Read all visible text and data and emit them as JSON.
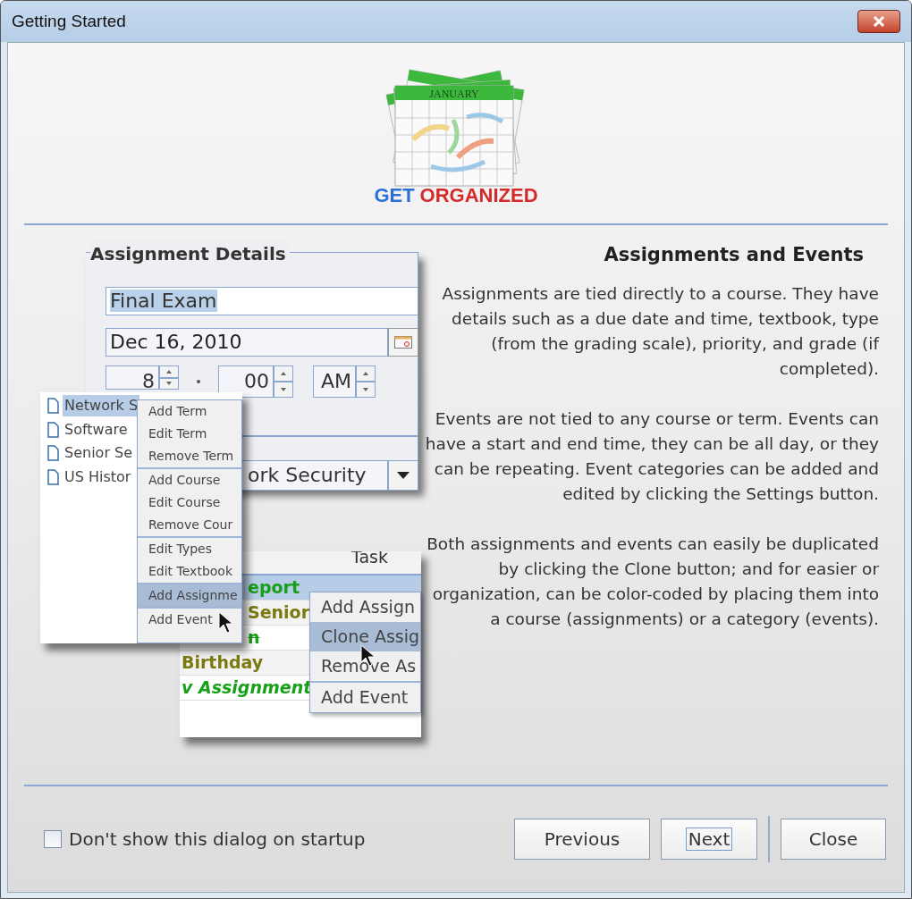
{
  "window": {
    "title": "Getting Started"
  },
  "logo": {
    "calendar_month": "JANUARY",
    "title_words": [
      "GET",
      "ORGANIZED"
    ]
  },
  "illustration": {
    "details_panel": {
      "title": "Assignment Details",
      "name_value": "Final Exam",
      "name_selected": true,
      "date_value": "Dec 16, 2010",
      "hour": "8",
      "minute": "00",
      "ampm": "AM",
      "course_value": "ork Security"
    },
    "tree": [
      {
        "label": "Network S",
        "selected": true
      },
      {
        "label": "Software",
        "selected": false
      },
      {
        "label": "Senior Se",
        "selected": false
      },
      {
        "label": "US Histor",
        "selected": false
      }
    ],
    "tree_menu": [
      [
        {
          "label": "Add Term",
          "selected": false
        },
        {
          "label": "Edit Term",
          "selected": false
        },
        {
          "label": "Remove Term",
          "selected": false
        }
      ],
      [
        {
          "label": "Add Course",
          "selected": false
        },
        {
          "label": "Edit Course",
          "selected": false
        },
        {
          "label": "Remove Cour",
          "selected": false
        }
      ],
      [
        {
          "label": "Edit Types",
          "selected": false
        },
        {
          "label": "Edit Textbook",
          "selected": false
        }
      ],
      [
        {
          "label": "Add Assignme",
          "selected": true
        }
      ],
      [
        {
          "label": "Add Event",
          "selected": false
        }
      ]
    ],
    "table": {
      "header": "Task",
      "rows": [
        {
          "text": "eport",
          "color": "#18a018",
          "kind": "plain",
          "selected": true
        },
        {
          "text": "Senior",
          "color": "#7a7a10",
          "kind": "plain",
          "selected": false
        },
        {
          "text": "n",
          "color": "#18a018",
          "kind": "done",
          "selected": false
        },
        {
          "text": "Birthday",
          "color": "#7a7a10",
          "kind": "plain",
          "selected": false
        },
        {
          "text": "v Assignment",
          "color": "#18a018",
          "kind": "new",
          "selected": false
        }
      ]
    },
    "table_menu": [
      [
        {
          "label": "Add Assign",
          "selected": false
        },
        {
          "label": "Clone Assig",
          "selected": true
        },
        {
          "label": "Remove As",
          "selected": false
        }
      ],
      [
        {
          "label": "Add Event",
          "selected": false
        }
      ]
    ]
  },
  "info": {
    "heading": "Assignments and Events",
    "paragraphs": [
      "Assignments are tied directly to a course. They have details such as a due date and time, textbook, type (from the grading scale), priority, and grade (if completed).",
      "Events are not tied to any course or term. Events can have a start and end time, they can be all day, or they can be repeating. Event categories can be added and edited by clicking the Settings button.",
      "Both assignments and events can easily be duplicated by clicking the Clone button; and for easier or organization, can be color-coded by placing them into a course (assignments) or a category (events)."
    ]
  },
  "footer": {
    "checkbox": {
      "label": "Don't show this dialog on startup",
      "checked": false
    },
    "buttons": [
      {
        "label": "Previous",
        "focused": false
      },
      {
        "label": "Next",
        "focused": true
      },
      {
        "label": "Close",
        "focused": false
      }
    ]
  }
}
